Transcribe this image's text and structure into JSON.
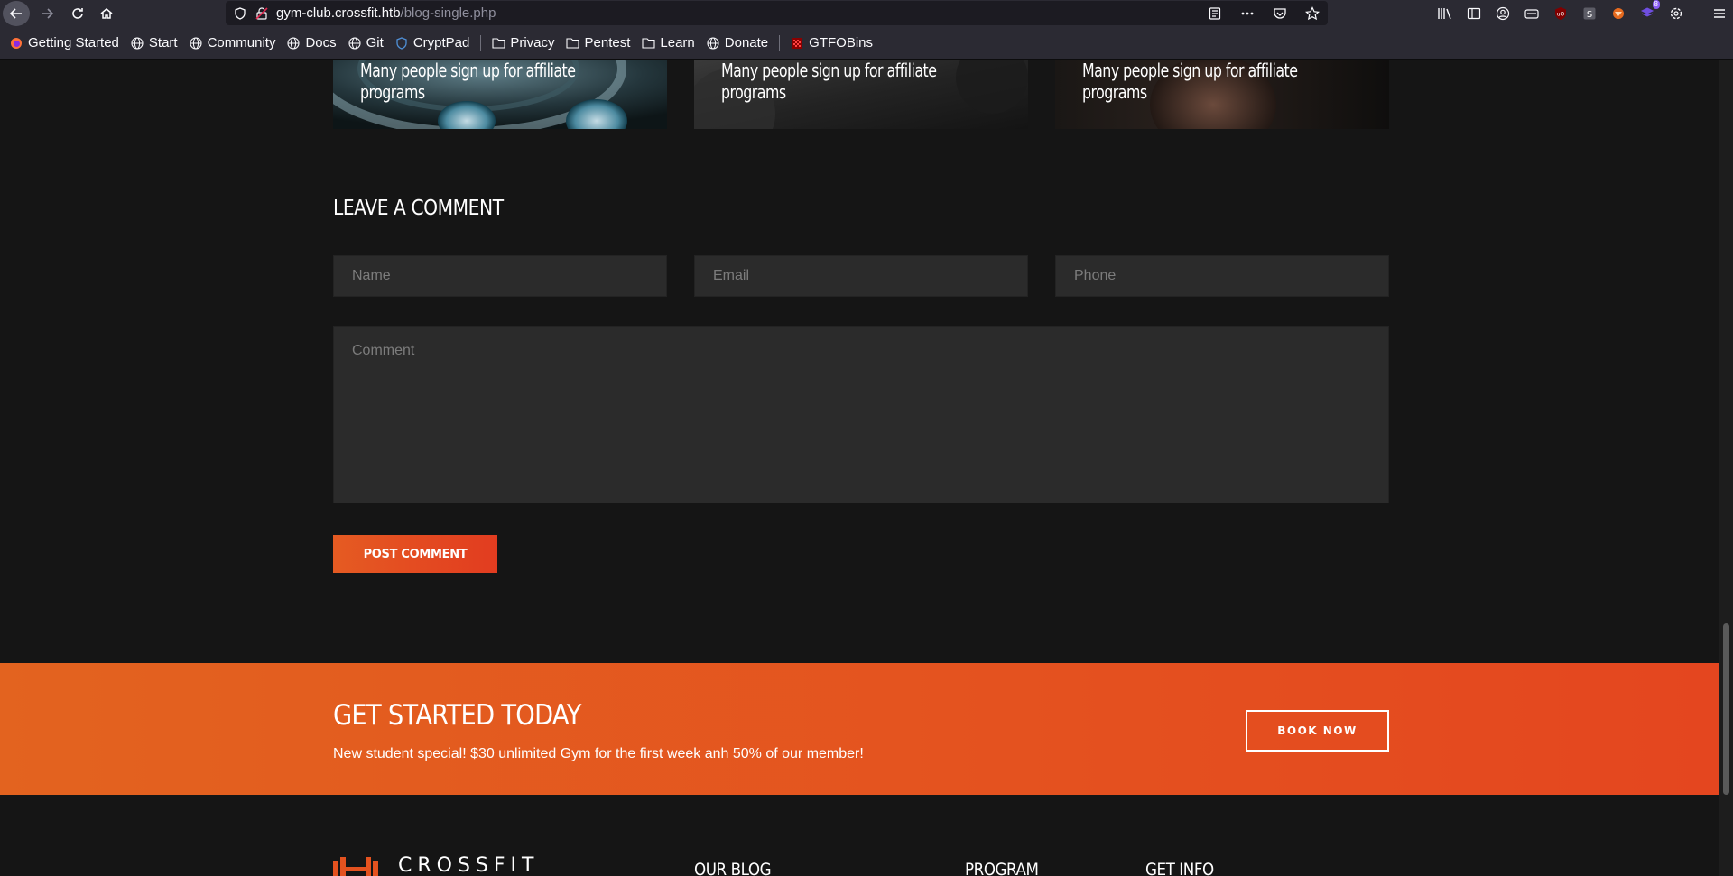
{
  "browser": {
    "url_host": "gym-club.crossfit.htb",
    "url_path": "/blog-single.php",
    "bookmarks": [
      {
        "label": "Getting Started",
        "icon": "firefox-icon"
      },
      {
        "label": "Start",
        "icon": "globe-icon"
      },
      {
        "label": "Community",
        "icon": "globe-icon"
      },
      {
        "label": "Docs",
        "icon": "globe-icon"
      },
      {
        "label": "Git",
        "icon": "globe-icon"
      },
      {
        "label": "CryptPad",
        "icon": "cryptpad-icon"
      },
      {
        "label": "Privacy",
        "icon": "folder-icon"
      },
      {
        "label": "Pentest",
        "icon": "folder-icon"
      },
      {
        "label": "Learn",
        "icon": "folder-icon"
      },
      {
        "label": "Donate",
        "icon": "globe-icon"
      },
      {
        "label": "GTFOBins",
        "icon": "gtfobins-icon"
      }
    ],
    "extension_badge": "8"
  },
  "related_posts": [
    {
      "title": "Many people sign up for affiliate programs"
    },
    {
      "title": "Many people sign up for affiliate programs"
    },
    {
      "title": "Many people sign up for affiliate programs"
    }
  ],
  "comment_form": {
    "heading": "LEAVE A COMMENT",
    "name_placeholder": "Name",
    "email_placeholder": "Email",
    "phone_placeholder": "Phone",
    "comment_placeholder": "Comment",
    "submit_label": "POST COMMENT"
  },
  "cta": {
    "title": "GET STARTED TODAY",
    "text": "New student special! $30 unlimited Gym for the first week anh 50% of our member!",
    "button_label": "BOOK NOW"
  },
  "footer": {
    "logo_text": "CROSSFIT",
    "columns": [
      "OUR BLOG",
      "PROGRAM",
      "GET INFO"
    ]
  },
  "colors": {
    "accent": "#e4521f",
    "page_bg": "#151515",
    "field_bg": "#2b2b2b"
  }
}
